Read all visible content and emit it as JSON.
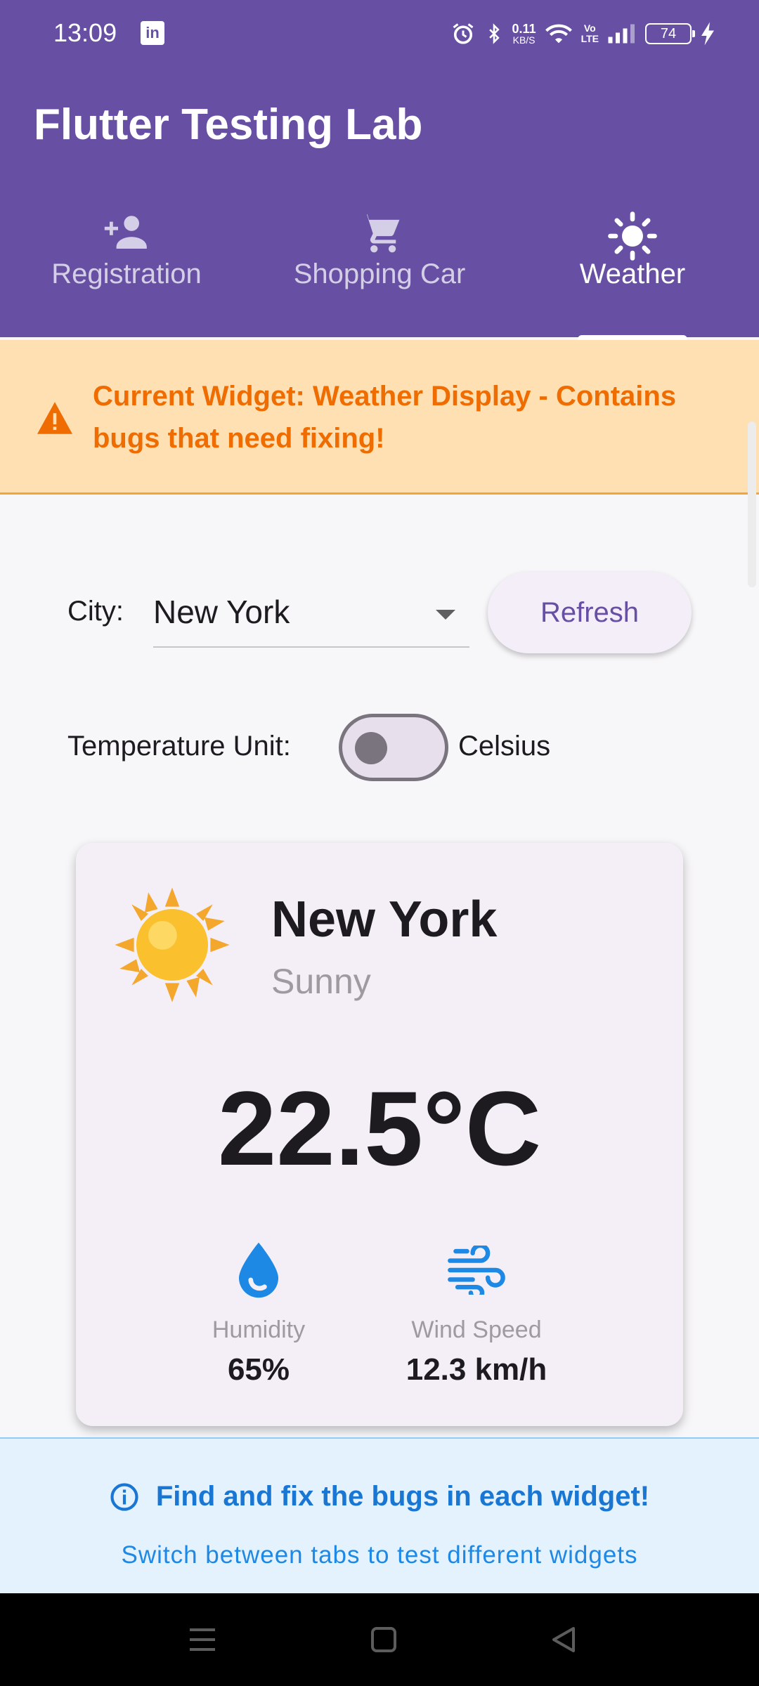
{
  "status_bar": {
    "time": "13:09",
    "app_icon_text": "in",
    "net_speed_value": "0.11",
    "net_speed_unit": "KB/S",
    "volte_top": "Vo",
    "volte_bottom": "LTE",
    "battery": "74",
    "icons": [
      "linkedin-icon",
      "alarm-icon",
      "bluetooth-icon",
      "wifi-icon",
      "signal-icon",
      "battery-icon",
      "charging-icon"
    ]
  },
  "app_bar": {
    "title": "Flutter Testing Lab",
    "background": "#6750a4"
  },
  "tabs": [
    {
      "label": "Registration",
      "icon": "person-add-icon",
      "active": false
    },
    {
      "label": "Shopping Car",
      "icon": "shopping-cart-icon",
      "active": false
    },
    {
      "label": "Weather",
      "icon": "sun-icon",
      "active": true
    }
  ],
  "warning": {
    "text": "Current Widget: Weather Display - Contains bugs that need fixing!",
    "icon": "warning-icon",
    "color": "#ef6c00",
    "background": "#ffe0b2"
  },
  "controls": {
    "city_label": "City:",
    "city_value": "New York",
    "refresh_label": "Refresh",
    "unit_label": "Temperature Unit:",
    "unit_value": "Celsius",
    "unit_toggle_on": false
  },
  "weather_card": {
    "city": "New York",
    "condition": "Sunny",
    "condition_icon": "sun-icon",
    "temperature": "22.5°C",
    "humidity_label": "Humidity",
    "humidity_value": "65%",
    "humidity_icon": "water-drop-icon",
    "wind_label": "Wind Speed",
    "wind_value": "12.3 km/h",
    "wind_icon": "wind-icon"
  },
  "footer": {
    "title": "Find and fix the bugs in each widget!",
    "subtitle": "Switch between tabs to test different widgets",
    "icon": "info-icon",
    "accent": "#1976d2"
  },
  "nav_bar": {
    "buttons": [
      "menu-icon",
      "home-icon",
      "back-icon"
    ]
  }
}
